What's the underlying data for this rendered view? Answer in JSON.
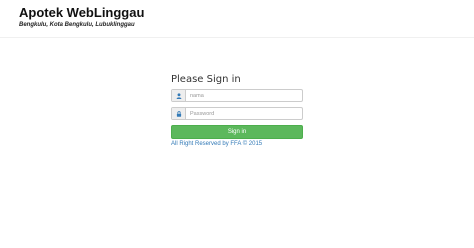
{
  "header": {
    "title": "Apotek WebLinggau",
    "subtitle": "Bengkulu, Kota Bengkulu, Lubuklinggau"
  },
  "login": {
    "heading": "Please Sign in",
    "username": {
      "placeholder": "nama",
      "value": "",
      "icon": "user-icon"
    },
    "password": {
      "placeholder": "Password",
      "value": "",
      "icon": "lock-icon"
    },
    "submit_label": "Sign in",
    "footer_text": "All Right Reserved by FFA © 2015"
  },
  "colors": {
    "accent": "#5cb85c",
    "link": "#337ab7",
    "icon": "#337ab7"
  }
}
